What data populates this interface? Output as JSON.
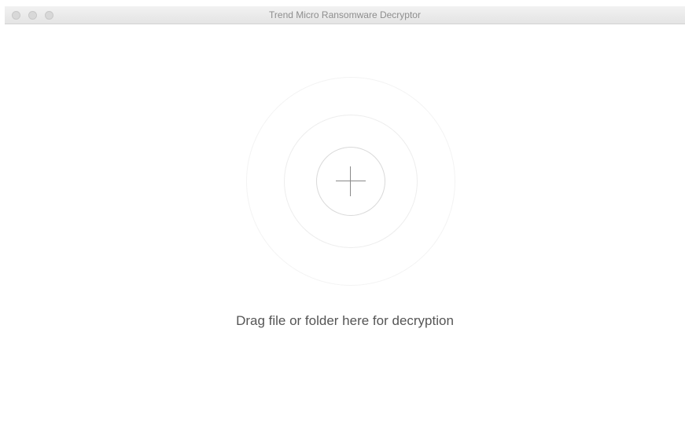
{
  "window": {
    "title": "Trend Micro Ransomware Decryptor",
    "controls": [
      "close",
      "minimize",
      "zoom"
    ]
  },
  "dropzone": {
    "icon": "plus-icon",
    "hint": "Drag file or folder here for decryption"
  },
  "colors": {
    "titlebar": "#e8e8e8",
    "title_text": "#8e8e8e",
    "hint_text": "#555555",
    "ring": "#d9d9d9"
  }
}
